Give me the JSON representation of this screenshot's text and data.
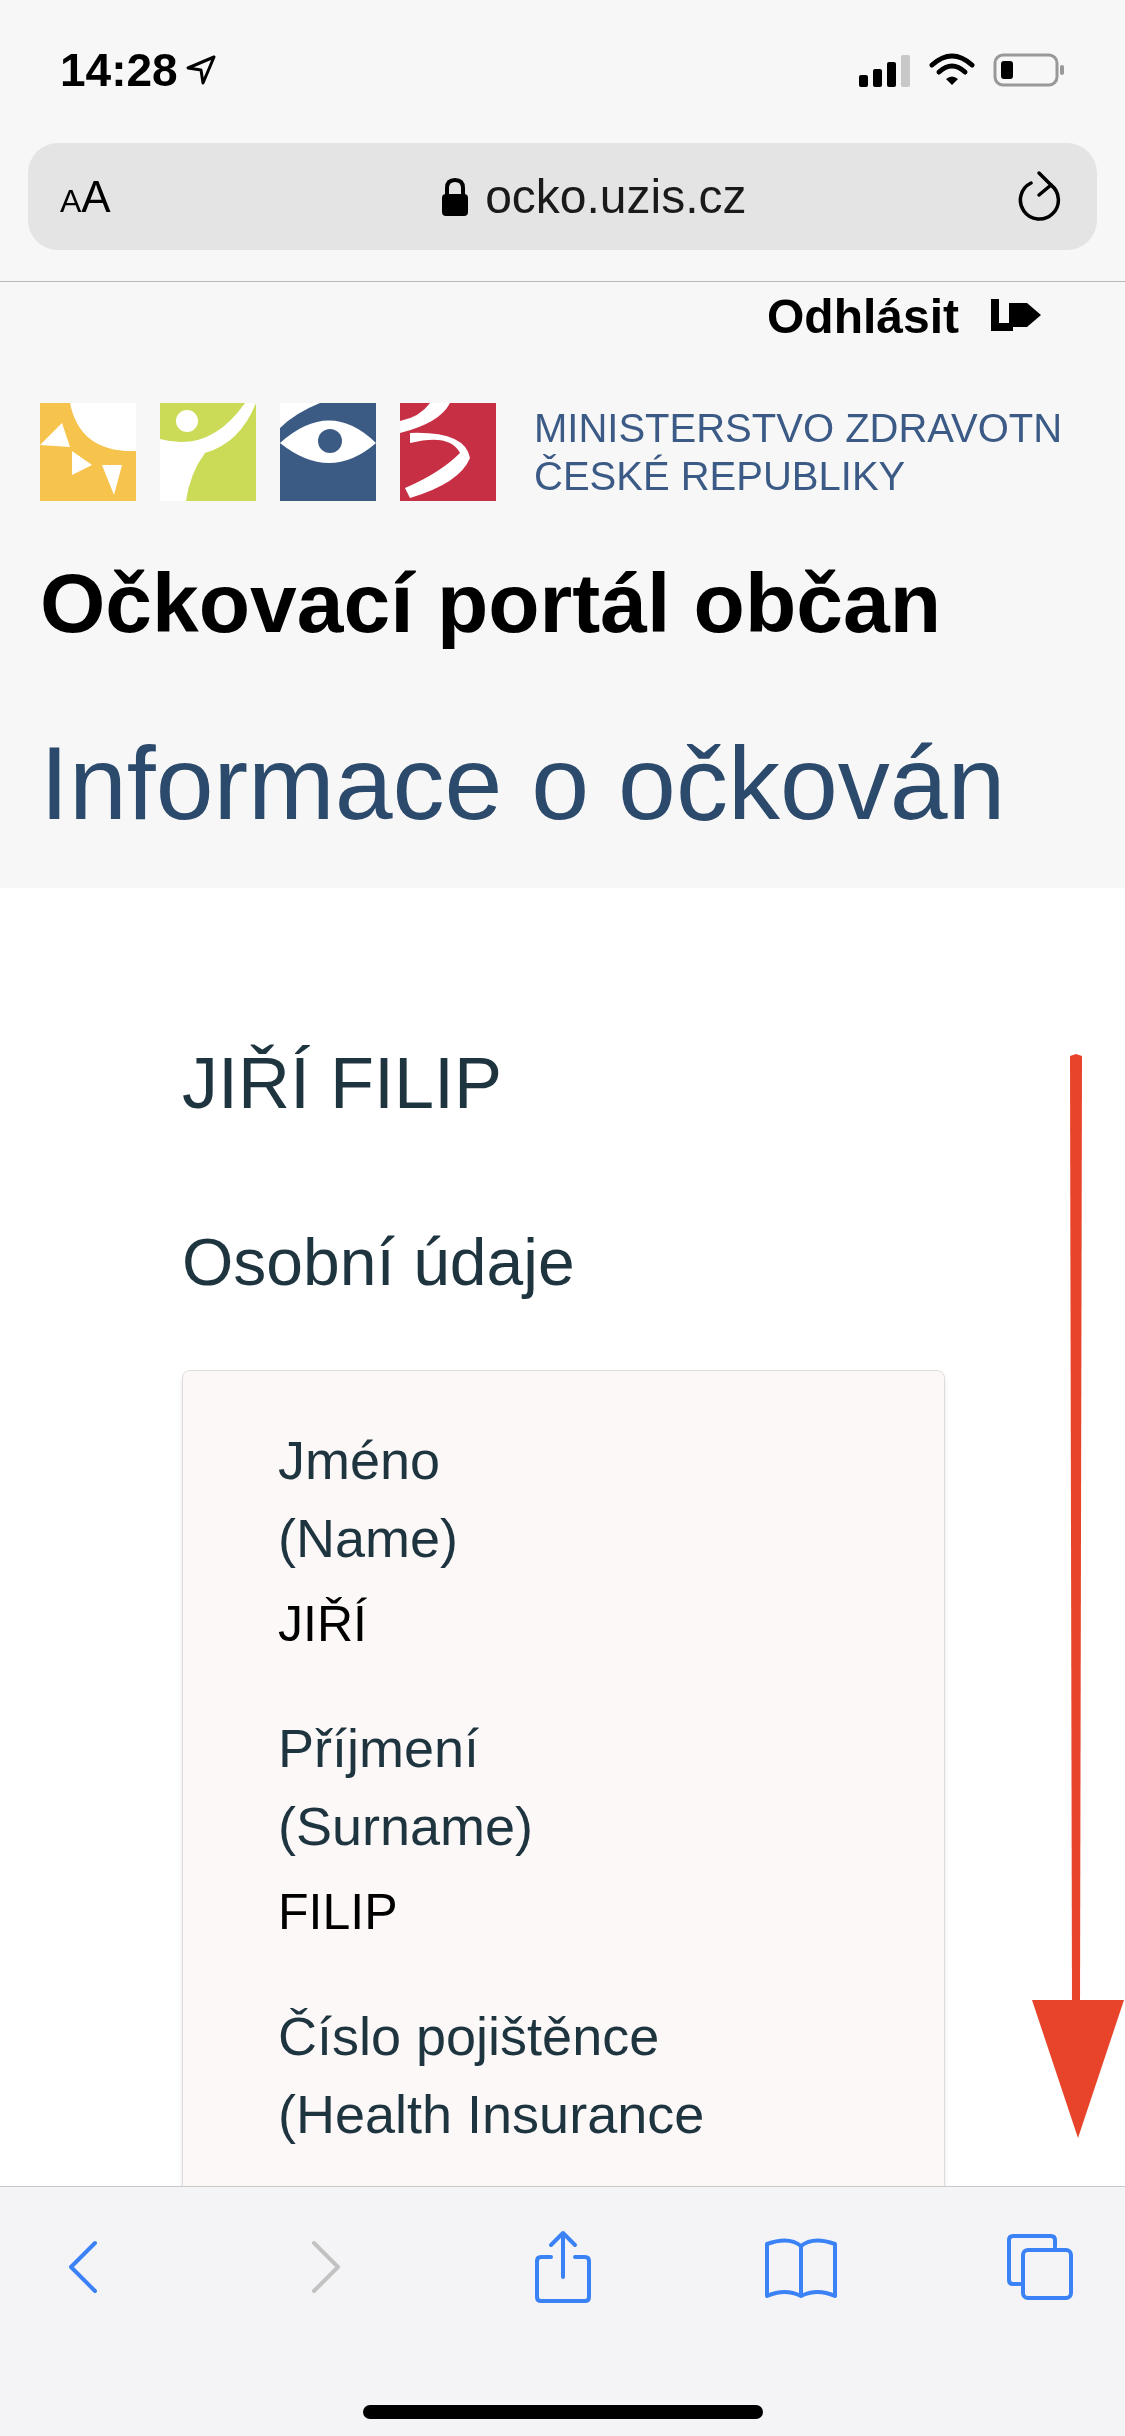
{
  "status_bar": {
    "time": "14:28"
  },
  "address_bar": {
    "text_size_button": {
      "small": "A",
      "large": "A"
    },
    "url": "ocko.uzis.cz"
  },
  "header": {
    "logout": "Odhlásit",
    "ministry": [
      "MINISTERSTVO ZDRAVOTN",
      "ČESKÉ REPUBLIKY"
    ],
    "portal_title": "Očkovací portál občan",
    "page_title": "Informace o očkován"
  },
  "person": {
    "name": "JIŘÍ FILIP",
    "section_title": "Osobní údaje",
    "fields": [
      {
        "label": "Jméno",
        "label_en": "(Name)",
        "value": "JIŘÍ"
      },
      {
        "label": "Příjmení",
        "label_en": "(Surname)",
        "value": "FILIP"
      },
      {
        "label": "Číslo pojištěnce",
        "label_en": "(Health Insurance"
      }
    ]
  },
  "toolbar": [
    {
      "kind": "back",
      "disabled": false
    },
    {
      "kind": "forward",
      "disabled": true
    },
    {
      "kind": "share",
      "disabled": false
    },
    {
      "kind": "bookmarks",
      "disabled": false
    },
    {
      "kind": "tabs",
      "disabled": false
    }
  ]
}
